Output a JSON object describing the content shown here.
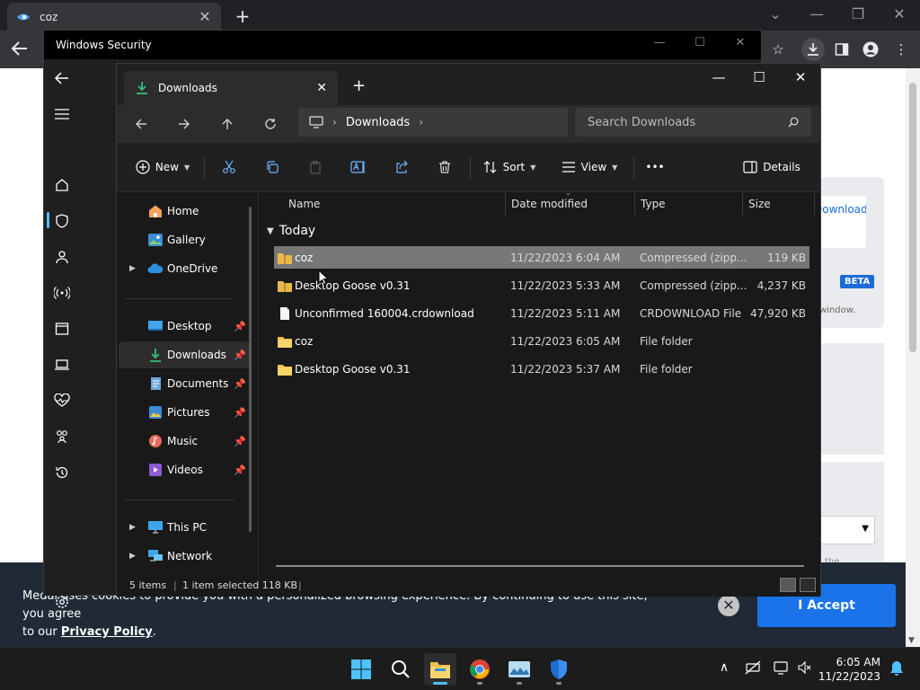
{
  "browser": {
    "tab_title": "coz",
    "new_tab_symbol": "+",
    "tab_close_symbol": "✕",
    "accent": "#1a73e8"
  },
  "page": {
    "download_button": "Download",
    "beta_badge": "BETA",
    "window_text": "window.",
    "the_text": "the",
    "cookie_text_1": "Medal uses cookies to provide you with a personalized browsing experience. By continuing to use this site, you agree",
    "cookie_text_2_prefix": "to our ",
    "cookie_policy_link": "Privacy Policy",
    "cookie_text_2_suffix": ".",
    "cookie_close": "✕",
    "accept_label": "I Accept"
  },
  "security": {
    "title": "Windows Security",
    "sidebar_icons": [
      "back-arrow-icon",
      "menu-icon",
      "home-icon",
      "shield-icon",
      "account-icon",
      "wireless-icon",
      "browser-icon",
      "laptop-icon",
      "heart-icon",
      "family-icon",
      "history-icon",
      "gear-icon"
    ]
  },
  "explorer": {
    "tab_title": "Downloads",
    "tab_close": "✕",
    "new_tab": "+",
    "address": {
      "location": "Downloads"
    },
    "search_placeholder": "Search Downloads",
    "commands": {
      "new": "New",
      "sort": "Sort",
      "view": "View",
      "more": "•••",
      "details": "Details"
    },
    "nav_items": [
      {
        "label": "Home",
        "icon": "home-icon"
      },
      {
        "label": "Gallery",
        "icon": "gallery-icon"
      },
      {
        "label": "OneDrive",
        "icon": "cloud-icon"
      },
      {
        "label": "Desktop",
        "icon": "desktop-icon"
      },
      {
        "label": "Downloads",
        "icon": "download-icon"
      },
      {
        "label": "Documents",
        "icon": "documents-icon"
      },
      {
        "label": "Pictures",
        "icon": "pictures-icon"
      },
      {
        "label": "Music",
        "icon": "music-icon"
      },
      {
        "label": "Videos",
        "icon": "videos-icon"
      },
      {
        "label": "This PC",
        "icon": "pc-icon"
      },
      {
        "label": "Network",
        "icon": "network-icon"
      }
    ],
    "columns": {
      "name": "Name",
      "date": "Date modified",
      "type": "Type",
      "size": "Size"
    },
    "group_label": "Today",
    "files": [
      {
        "name": "coz",
        "date": "11/22/2023 6:04 AM",
        "type": "Compressed (zipp...",
        "size": "119 KB",
        "icon": "zip-folder-icon"
      },
      {
        "name": "Desktop Goose v0.31",
        "date": "11/22/2023 5:33 AM",
        "type": "Compressed (zipp...",
        "size": "4,237 KB",
        "icon": "zip-folder-icon"
      },
      {
        "name": "Unconfirmed 160004.crdownload",
        "date": "11/22/2023 5:11 AM",
        "type": "CRDOWNLOAD File",
        "size": "47,920 KB",
        "icon": "file-icon"
      },
      {
        "name": "coz",
        "date": "11/22/2023 6:05 AM",
        "type": "File folder",
        "size": "",
        "icon": "folder-icon"
      },
      {
        "name": "Desktop Goose v0.31",
        "date": "11/22/2023 5:37 AM",
        "type": "File folder",
        "size": "",
        "icon": "folder-icon"
      }
    ],
    "status": {
      "count": "5 items",
      "selected": "1 item selected  118 KB",
      "separator": "|"
    }
  },
  "taskbar": {
    "time": "6:05 AM",
    "date": "11/22/2023",
    "tray_up_arrow": "∧"
  }
}
